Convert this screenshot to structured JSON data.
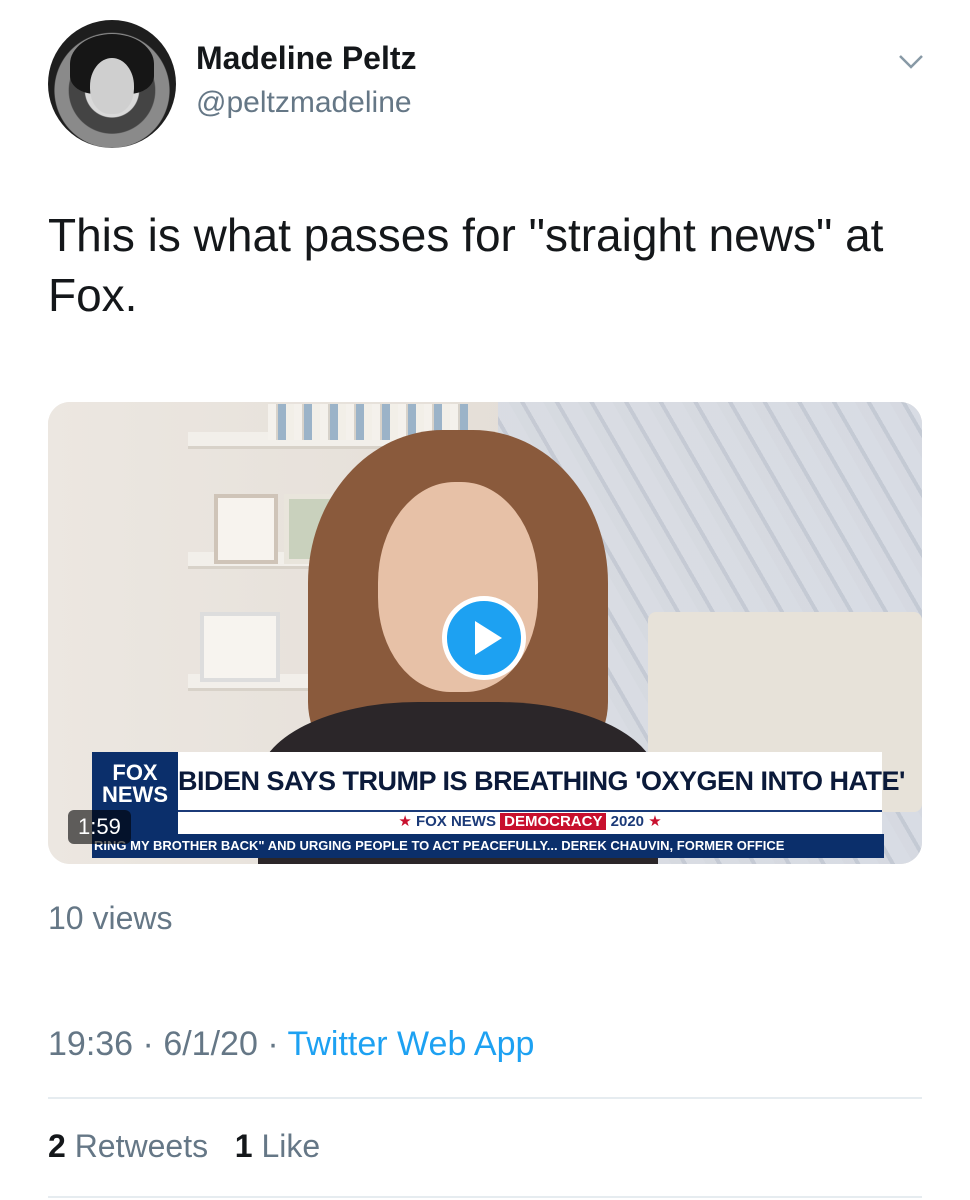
{
  "author": {
    "name": "Madeline Peltz",
    "handle": "@peltzmadeline"
  },
  "tweet": {
    "text": "This is what passes for \"straight news\" at Fox."
  },
  "media": {
    "duration": "1:59",
    "headline": "BIDEN SAYS TRUMP IS BREATHING 'OXYGEN INTO HATE'",
    "network_logo_line1": "FOX",
    "network_logo_line2": "NEWS",
    "subbar_brand": "FOX NEWS",
    "subbar_democracy": "DEMOCRACY",
    "subbar_year": "2020",
    "ticker": "RING MY BROTHER BACK\" AND URGING PEOPLE TO ACT PEACEFULLY...   DEREK CHAUVIN, FORMER OFFICE"
  },
  "views": "10 views",
  "timestamp": {
    "time": "19:36",
    "date": "6/1/20",
    "separator": "·",
    "source": "Twitter Web App"
  },
  "stats": {
    "retweets_count": "2",
    "retweets_label": "Retweets",
    "likes_count": "1",
    "likes_label": "Like"
  },
  "colors": {
    "accent": "#1da1f2",
    "secondary_text": "#657786",
    "primary_text": "#14171a"
  }
}
